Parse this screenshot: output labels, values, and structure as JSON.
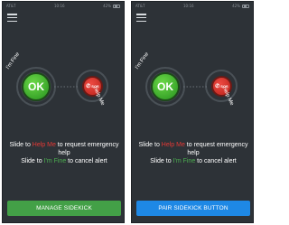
{
  "colors": {
    "background": "#2d3237",
    "ok_green": "#3aa62a",
    "sos_red": "#c42a22",
    "help_text_red": "#e53935",
    "fine_text_green": "#4caf50",
    "manage_button_green": "#43a047",
    "pair_button_blue": "#1e88e5"
  },
  "screens": [
    {
      "status": {
        "carrier": "AT&T",
        "time": "10:16",
        "battery": "42%"
      },
      "ok_label": "OK",
      "sos_label": "SOS",
      "fine_label": "I'm Fine",
      "help_label": "Help Me",
      "instruction": {
        "line1_prefix": "Slide to ",
        "line1_keyword": "Help Me",
        "line1_suffix": " to request emergency help",
        "line2_prefix": "Slide to ",
        "line2_keyword": "I'm Fine",
        "line2_suffix": " to cancel alert"
      },
      "action_button": "Manage Sidekick"
    },
    {
      "status": {
        "carrier": "AT&T",
        "time": "10:16",
        "battery": "42%"
      },
      "ok_label": "OK",
      "sos_label": "SOS",
      "fine_label": "I'm Fine",
      "help_label": "Help Me",
      "instruction": {
        "line1_prefix": "Slide to ",
        "line1_keyword": "Help Me",
        "line1_suffix": " to request emergency help",
        "line2_prefix": "Slide to ",
        "line2_keyword": "I'm Fine",
        "line2_suffix": " to cancel alert"
      },
      "action_button": "Pair Sidekick Button"
    }
  ]
}
